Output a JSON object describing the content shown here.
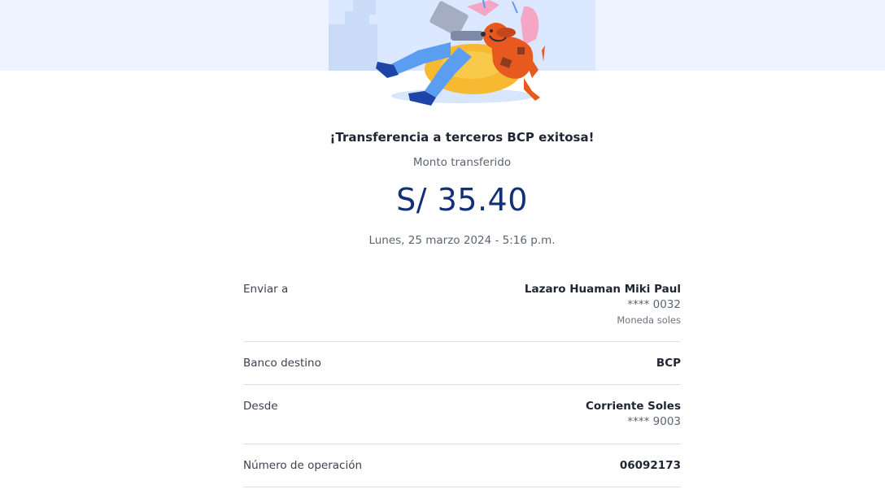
{
  "receipt": {
    "title": "¡Transferencia a terceros BCP exitosa!",
    "amount_label": "Monto transferido",
    "amount": "S/ 35.40",
    "datetime": "Lunes, 25 marzo 2024 - 5:16 p.m."
  },
  "details": {
    "send_to": {
      "label": "Enviar a",
      "name": "Lazaro Huaman Miki Paul",
      "account": "**** 0032",
      "currency": "Moneda soles"
    },
    "bank": {
      "label": "Banco destino",
      "value": "BCP"
    },
    "from": {
      "label": "Desde",
      "account_type": "Corriente Soles",
      "account": "**** 9003"
    },
    "operation": {
      "label": "Número de operación",
      "value": "06092173"
    }
  },
  "colors": {
    "amount": "#12307a",
    "band": "#eef4ff",
    "illustration_bg": "#dbe8ff"
  }
}
